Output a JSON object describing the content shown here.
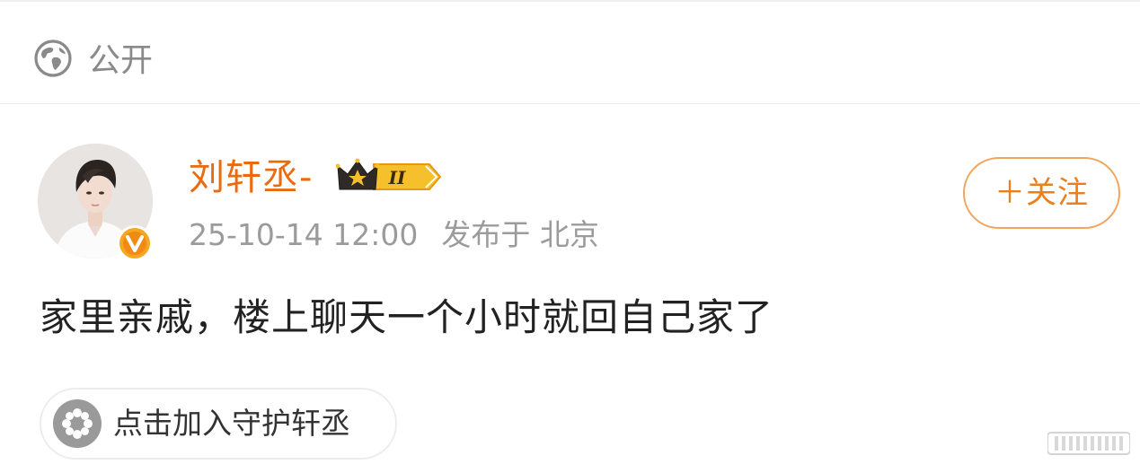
{
  "visibility": {
    "icon": "globe-icon",
    "label": "公开"
  },
  "post": {
    "author": {
      "name": "刘轩丞-",
      "avatar": "avatar-photo",
      "verified_icon": "verified-v-icon",
      "vip_icon": "crown-level-badge-icon",
      "vip_level": "II"
    },
    "time": "25-10-14 12:00",
    "location": "发布于 北京",
    "follow_label": "＋关注",
    "text": "家里亲戚，楼上聊天一个小时就回自己家了",
    "guard_chip": {
      "icon": "flower-icon",
      "label": "点击加入守护轩丞"
    }
  },
  "colors": {
    "username": "#e86b12",
    "follow_border": "#f1a45c",
    "follow_text": "#e8801f",
    "meta_text": "#9b9b9b",
    "body_text": "#222222"
  }
}
